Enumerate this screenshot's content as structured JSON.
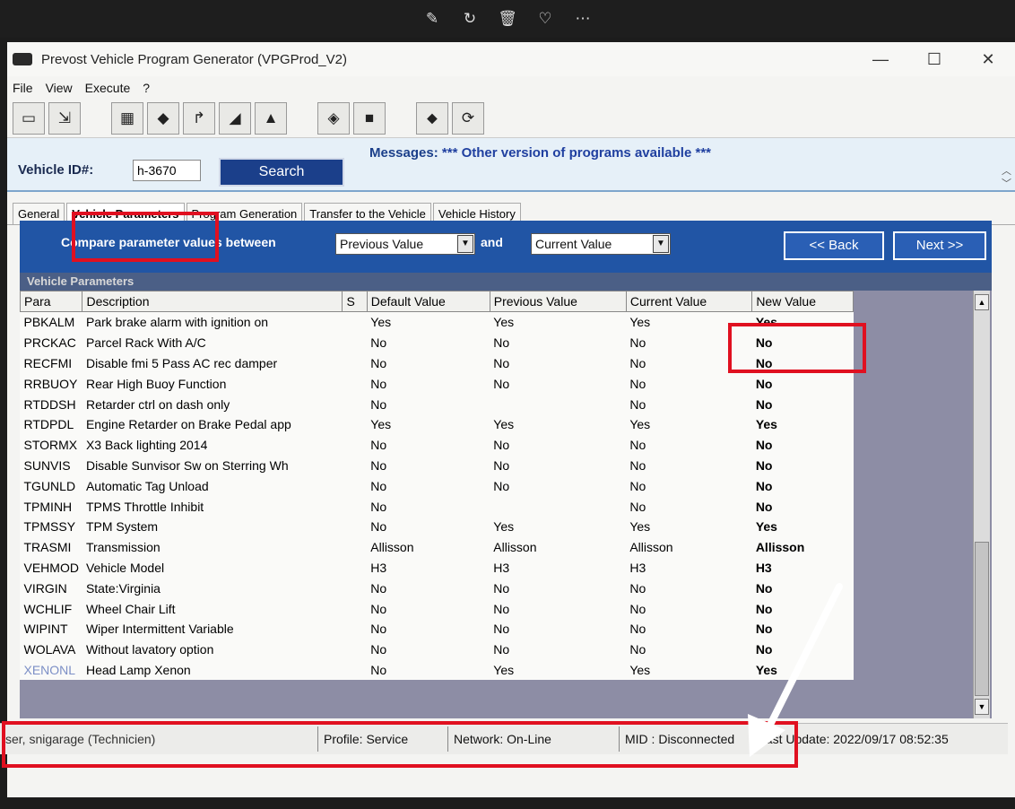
{
  "viewer": {
    "icons": [
      "edit-icon",
      "rotate-icon",
      "trash-icon",
      "heart-icon",
      "more-icon"
    ]
  },
  "window": {
    "title": "Prevost Vehicle Program Generator (VPGProd_V2)",
    "controls": {
      "minimize": "—",
      "maximize": "☐",
      "close": "✕"
    }
  },
  "menu": [
    "File",
    "View",
    "Execute",
    "?"
  ],
  "header": {
    "vehicle_id_label": "Vehicle ID#:",
    "vehicle_id_value": "h-3670",
    "search_label": "Search",
    "messages_label": "Messages:",
    "messages_text": "*** Other version of programs available ***"
  },
  "tabs": [
    "General",
    "Vehicle Parameters",
    "Program Generation",
    "Transfer to the Vehicle",
    "Vehicle History"
  ],
  "active_tab": "Vehicle Parameters",
  "compare": {
    "label": "Compare parameter values between",
    "from": "Previous Value",
    "and": "and",
    "to": "Current Value",
    "back": "<< Back",
    "next": "Next >>"
  },
  "panel_title": "Vehicle Parameters",
  "grid": {
    "columns": [
      "Para",
      "Description",
      "S",
      "Default Value",
      "Previous Value",
      "Current Value",
      "New Value"
    ],
    "rows": [
      [
        "PBKALM",
        "Park brake alarm with ignition on",
        "",
        "Yes",
        "Yes",
        "Yes",
        "Yes"
      ],
      [
        "PRCKAC",
        "Parcel Rack With A/C",
        "",
        "No",
        "No",
        "No",
        "No"
      ],
      [
        "RECFMI",
        "Disable fmi 5 Pass AC rec damper",
        "",
        "No",
        "No",
        "No",
        "No"
      ],
      [
        "RRBUOY",
        "Rear High Buoy Function",
        "",
        "No",
        "No",
        "No",
        "No"
      ],
      [
        "RTDDSH",
        "Retarder ctrl on dash only",
        "",
        "No",
        "",
        "No",
        "No"
      ],
      [
        "RTDPDL",
        "Engine Retarder on Brake Pedal app",
        "",
        "Yes",
        "Yes",
        "Yes",
        "Yes"
      ],
      [
        "STORMX",
        "X3 Back lighting 2014",
        "",
        "No",
        "No",
        "No",
        "No"
      ],
      [
        "SUNVIS",
        "Disable Sunvisor Sw on Sterring Wh",
        "",
        "No",
        "No",
        "No",
        "No"
      ],
      [
        "TGUNLD",
        "Automatic Tag Unload",
        "",
        "No",
        "No",
        "No",
        "No"
      ],
      [
        "TPMINH",
        "TPMS Throttle Inhibit",
        "",
        "No",
        "",
        "No",
        "No"
      ],
      [
        "TPMSSY",
        "TPM System",
        "",
        "No",
        "Yes",
        "Yes",
        "Yes"
      ],
      [
        "TRASMI",
        "Transmission",
        "",
        "Allisson",
        "Allisson",
        "Allisson",
        "Allisson"
      ],
      [
        "VEHMOD",
        "Vehicle Model",
        "",
        "H3",
        "H3",
        "H3",
        "H3"
      ],
      [
        "VIRGIN",
        "State:Virginia",
        "",
        "No",
        "No",
        "No",
        "No"
      ],
      [
        "WCHLIF",
        "Wheel Chair Lift",
        "",
        "No",
        "No",
        "No",
        "No"
      ],
      [
        "WIPINT",
        "Wiper Intermittent Variable",
        "",
        "No",
        "No",
        "No",
        "No"
      ],
      [
        "WOLAVA",
        "Without lavatory option",
        "",
        "No",
        "No",
        "No",
        "No"
      ],
      [
        "XENONL",
        "Head Lamp Xenon",
        "",
        "No",
        "Yes",
        "Yes",
        "Yes"
      ]
    ]
  },
  "status": {
    "user": "ser, snigarage (Technicien)",
    "profile": "Profile: Service",
    "network": "Network: On-Line",
    "mid": "MID : Disconnected",
    "last_update": "Last Update: 2022/09/17 08:52:35"
  },
  "colors": {
    "accent": "#1b3f8a",
    "annotation_red": "#e01020",
    "panel_blue": "#3e78b3"
  }
}
